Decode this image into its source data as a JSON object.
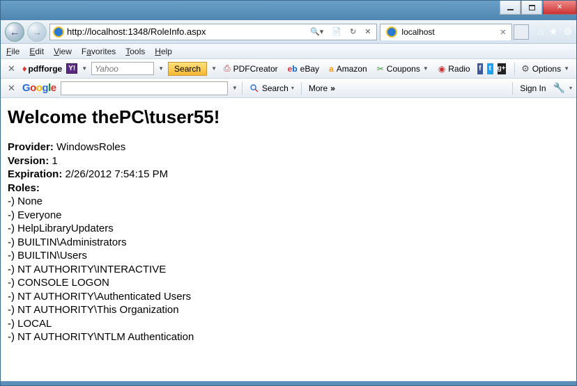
{
  "address": {
    "url": "http://localhost:1348/RoleInfo.aspx",
    "search_hint": "🔍"
  },
  "tab": {
    "title": "localhost"
  },
  "menu": {
    "file": "File",
    "edit": "Edit",
    "view": "View",
    "favorites": "Favorites",
    "tools": "Tools",
    "help": "Help"
  },
  "tbA": {
    "pdfforge": "pdfforge",
    "yahoo_placeholder": "Yahoo",
    "search": "Search",
    "pdfcreator": "PDFCreator",
    "ebay": "eBay",
    "amazon": "Amazon",
    "coupons": "Coupons",
    "radio": "Radio",
    "options": "Options"
  },
  "tbB": {
    "search": "Search",
    "more": "More",
    "signin": "Sign In"
  },
  "page": {
    "heading": "Welcome thePC\\tuser55!",
    "provider_label": "Provider:",
    "provider_value": " WindowsRoles",
    "version_label": "Version:",
    "version_value": " 1",
    "expiration_label": "Expiration:",
    "expiration_value": " 2/26/2012 7:54:15 PM",
    "roles_label": "Roles:",
    "roles": [
      "-) None",
      "-) Everyone",
      "-) HelpLibraryUpdaters",
      "-) BUILTIN\\Administrators",
      "-) BUILTIN\\Users",
      "-) NT AUTHORITY\\INTERACTIVE",
      "-) CONSOLE LOGON",
      "-) NT AUTHORITY\\Authenticated Users",
      "-) NT AUTHORITY\\This Organization",
      "-) LOCAL",
      "-) NT AUTHORITY\\NTLM Authentication"
    ]
  }
}
